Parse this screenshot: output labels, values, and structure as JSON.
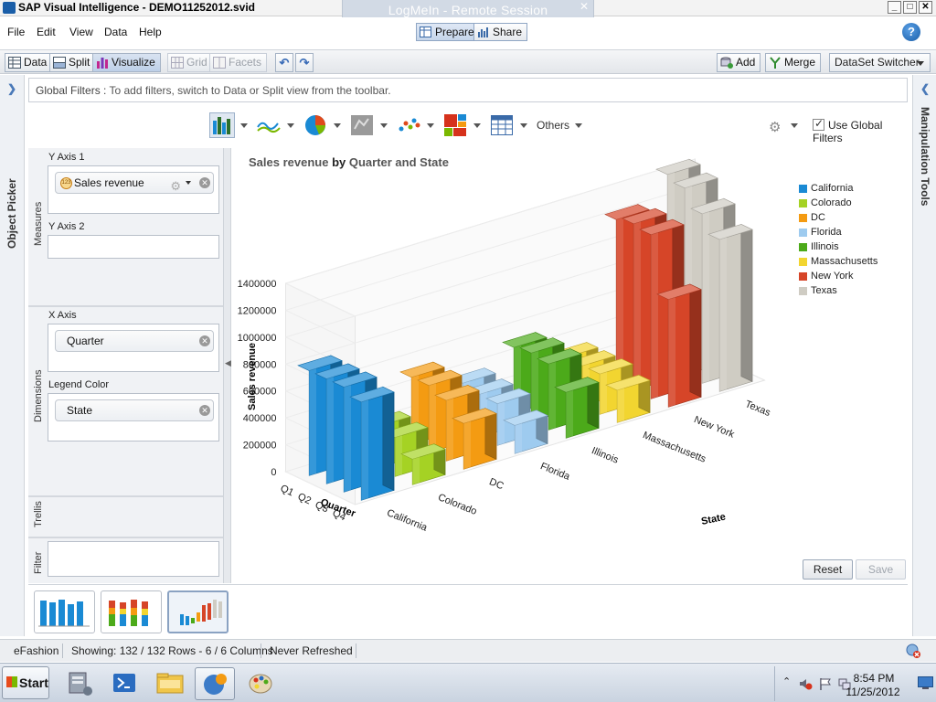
{
  "window": {
    "title": "SAP Visual Intelligence - DEMO11252012.svid",
    "remote_session_label": "LogMeIn - Remote Session",
    "remote_close": "✕",
    "min_btn": "_",
    "max_btn": "□",
    "close_btn": "✕"
  },
  "menu": {
    "file": "File",
    "edit": "Edit",
    "view": "View",
    "data": "Data",
    "help": "Help",
    "prepare": "Prepare",
    "share": "Share",
    "help_icon": "?"
  },
  "toolbar": {
    "data": "Data",
    "split": "Split",
    "visualize": "Visualize",
    "grid": "Grid",
    "facets": "Facets",
    "undo": "↶",
    "redo": "↷",
    "add": "Add",
    "merge": "Merge",
    "dataset_switcher": "DataSet Switcher"
  },
  "side_panels": {
    "left_label": "Object Picker",
    "right_label": "Manipulation Tools"
  },
  "global_filters": {
    "label": "Global Filters :",
    "hint": "To add filters, switch to Data or Split view from the toolbar."
  },
  "chart_toolbar": {
    "others_label": "Others",
    "use_global_filters": "Use Global Filters"
  },
  "feed_panel": {
    "measures_label": "Measures",
    "dimensions_label": "Dimensions",
    "trellis_label": "Trellis",
    "filter_label": "Filter",
    "y_axis_1": "Y Axis 1",
    "y_axis_1_value": "Sales revenue",
    "measure_icon_text": "123",
    "y_axis_2": "Y Axis 2",
    "x_axis": "X Axis",
    "x_axis_value": "Quarter",
    "legend_color": "Legend Color",
    "legend_color_value": "State",
    "remove_icon": "✕"
  },
  "chart_data": {
    "type": "bar",
    "title_measure": "Sales revenue",
    "title_by": " by ",
    "title_dims": "Quarter and State",
    "xlabel": "Quarter",
    "zlabel": "State",
    "ylabel": "Sales revenue",
    "ylim": [
      0,
      1400000
    ],
    "yticks": [
      "0",
      "200000",
      "400000",
      "600000",
      "800000",
      "1000000",
      "1200000",
      "1400000"
    ],
    "categories": [
      "Q1",
      "Q2",
      "Q3",
      "Q4"
    ],
    "series": [
      {
        "name": "California",
        "color": "#1a8ad4",
        "values": [
          780000,
          780000,
          780000,
          730000
        ]
      },
      {
        "name": "Colorado",
        "color": "#a5d224",
        "values": [
          310000,
          310000,
          290000,
          190000
        ]
      },
      {
        "name": "DC",
        "color": "#f49b12",
        "values": [
          500000,
          500000,
          450000,
          340000
        ]
      },
      {
        "name": "Florida",
        "color": "#9ecbef",
        "values": [
          340000,
          320000,
          310000,
          210000
        ]
      },
      {
        "name": "Illinois",
        "color": "#4caa1a",
        "values": [
          490000,
          510000,
          490000,
          340000
        ]
      },
      {
        "name": "Massachusetts",
        "color": "#f2d530",
        "values": [
          300000,
          300000,
          300000,
          240000
        ]
      },
      {
        "name": "New York",
        "color": "#d64528",
        "values": [
          1210000,
          1240000,
          1220000,
          800000
        ]
      },
      {
        "name": "Texas",
        "color": "#cfccc3",
        "values": [
          1430000,
          1390000,
          1260000,
          1130000
        ]
      }
    ],
    "legend_position": "top-right",
    "grid": true
  },
  "chart_buttons": {
    "reset": "Reset",
    "save": "Save"
  },
  "statusbar": {
    "source": "eFashion",
    "showing": "Showing: 132 / 132 Rows - 6 / 6 Columns",
    "refresh": "Never Refreshed"
  },
  "taskbar": {
    "start": "Start",
    "time": "8:54 PM",
    "date": "11/25/2012"
  }
}
